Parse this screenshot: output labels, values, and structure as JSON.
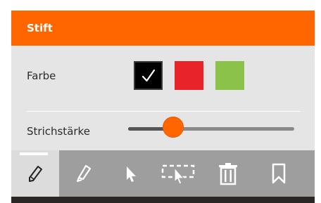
{
  "panel": {
    "title": "Stift",
    "color_label": "Farbe",
    "stroke_label": "Strichstärke",
    "colors": [
      {
        "name": "black",
        "hex": "#000000",
        "selected": true
      },
      {
        "name": "red",
        "hex": "#e8232a",
        "selected": false
      },
      {
        "name": "green",
        "hex": "#8bc34a",
        "selected": false
      }
    ],
    "stroke_width_fraction": 0.27,
    "accent_color": "#ff6600"
  },
  "toolbar": {
    "tools": [
      {
        "icon": "pencil-icon",
        "active": true
      },
      {
        "icon": "marker-icon",
        "active": false
      },
      {
        "icon": "pointer-icon",
        "active": false
      },
      {
        "icon": "selection-icon",
        "active": false
      },
      {
        "icon": "trash-icon",
        "active": false
      },
      {
        "icon": "bookmark-icon",
        "active": false
      }
    ]
  }
}
